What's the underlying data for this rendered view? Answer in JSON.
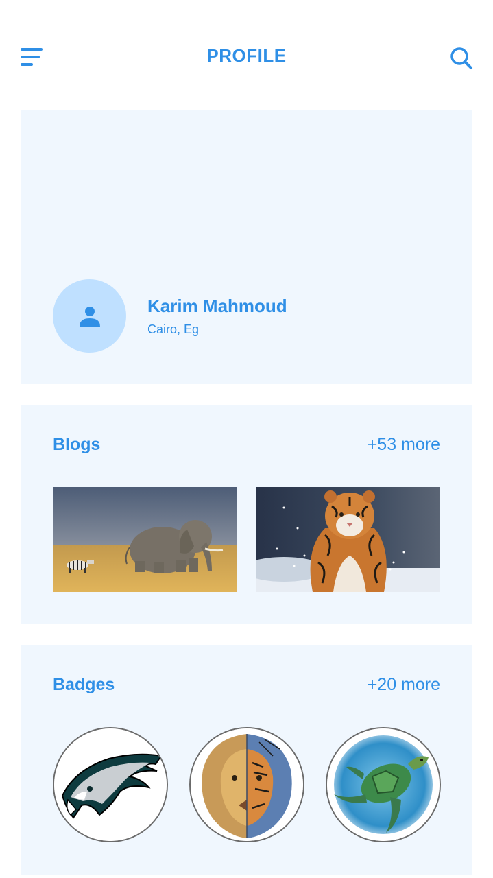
{
  "header": {
    "title": "PROFILE"
  },
  "profile": {
    "name": "Karim Mahmoud",
    "location": "Cairo, Eg"
  },
  "blogs": {
    "title": "Blogs",
    "more": "+53 more",
    "items": [
      {
        "subject": "elephant-and-zebra"
      },
      {
        "subject": "tiger-in-snow"
      }
    ]
  },
  "badges": {
    "title": "Badges",
    "more": "+20 more",
    "items": [
      {
        "subject": "eagle-head"
      },
      {
        "subject": "lion-tiger-split-face"
      },
      {
        "subject": "sea-turtle"
      }
    ]
  },
  "colors": {
    "accent": "#2f8fe6",
    "card_bg": "#f0f7fe",
    "avatar_bg": "#bfe0ff"
  }
}
